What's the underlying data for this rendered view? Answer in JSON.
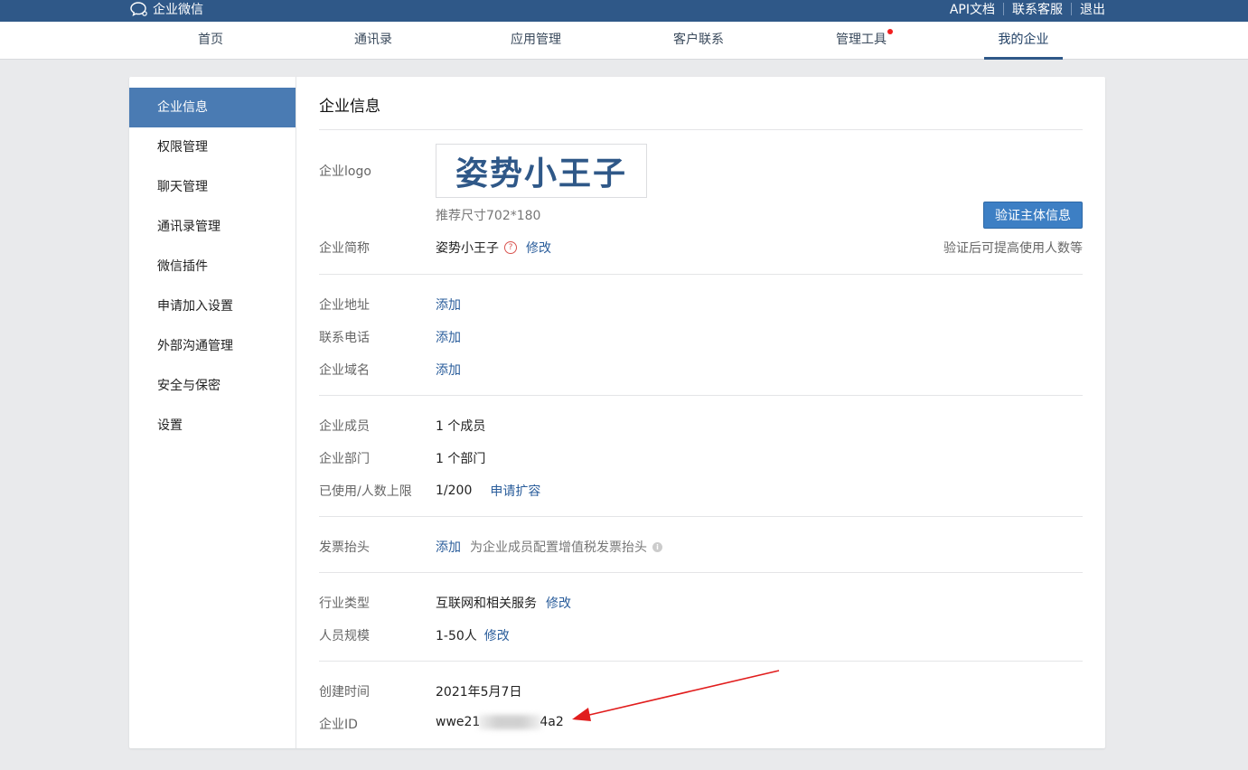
{
  "topbar": {
    "brand": "企业微信",
    "links": [
      "API文档",
      "联系客服",
      "退出"
    ]
  },
  "nav": {
    "items": [
      "首页",
      "通讯录",
      "应用管理",
      "客户联系",
      "管理工具",
      "我的企业"
    ],
    "active": "我的企业"
  },
  "sidebar": {
    "items": [
      "企业信息",
      "权限管理",
      "聊天管理",
      "通讯录管理",
      "微信插件",
      "申请加入设置",
      "外部沟通管理",
      "安全与保密",
      "设置"
    ],
    "active": "企业信息"
  },
  "main": {
    "title": "企业信息",
    "logo": {
      "label": "企业logo",
      "text": "姿势小王子",
      "size_hint": "推荐尺寸702*180"
    },
    "verify_button": "验证主体信息",
    "verify_tip": "验证后可提高使用人数等",
    "short_name": {
      "label": "企业简称",
      "value": "姿势小王子",
      "action": "修改"
    },
    "address": {
      "label": "企业地址",
      "action": "添加"
    },
    "phone": {
      "label": "联系电话",
      "action": "添加"
    },
    "domain": {
      "label": "企业域名",
      "action": "添加"
    },
    "members": {
      "label": "企业成员",
      "value": "1 个成员"
    },
    "departments": {
      "label": "企业部门",
      "value": "1 个部门"
    },
    "quota": {
      "label": "已使用/人数上限",
      "value": "1/200",
      "action": "申请扩容"
    },
    "invoice": {
      "label": "发票抬头",
      "action": "添加",
      "desc": "为企业成员配置增值税发票抬头"
    },
    "industry": {
      "label": "行业类型",
      "value": "互联网和相关服务",
      "action": "修改"
    },
    "scale": {
      "label": "人员规模",
      "value": "1-50人",
      "action": "修改"
    },
    "created": {
      "label": "创建时间",
      "value": "2021年5月7日"
    },
    "corp_id": {
      "label": "企业ID",
      "prefix": "wwe21",
      "suffix": "4a2"
    }
  },
  "colors": {
    "topbar": "#2f5888",
    "sidebar_active": "#4a7bb3",
    "button": "#3d7fc4",
    "link": "#2a5d9b",
    "annotation_arrow": "#e11d1d"
  }
}
